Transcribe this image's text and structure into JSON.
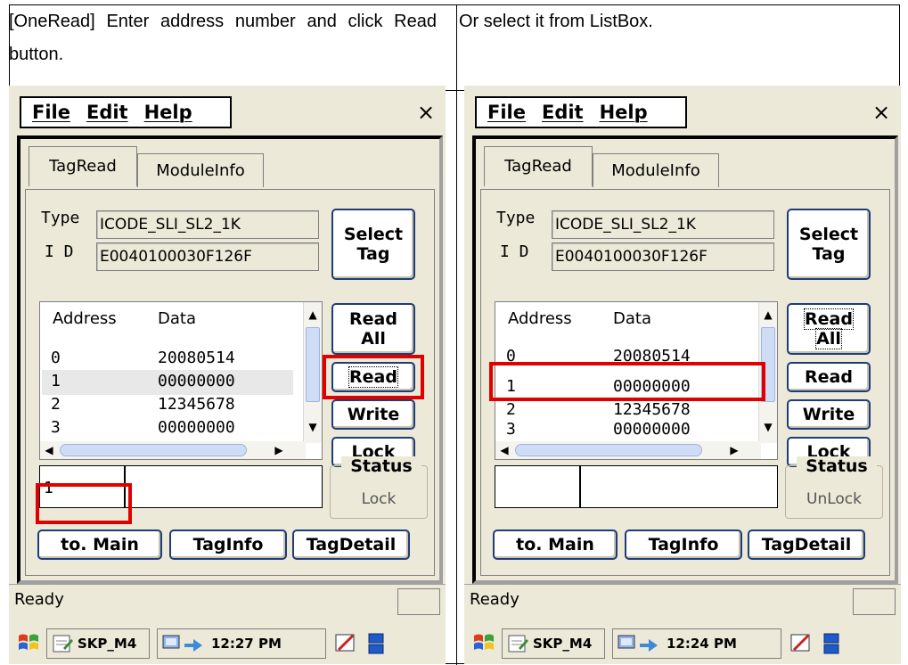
{
  "captions": {
    "left": "[OneRead] Enter address number and click Read button.",
    "right": "Or select it from ListBox."
  },
  "menu": {
    "file": "File",
    "edit": "Edit",
    "help": "Help",
    "close": "×"
  },
  "tabs": {
    "tagread": "TagRead",
    "moduleinfo": "ModuleInfo"
  },
  "labels": {
    "type": "Type",
    "id": "I D"
  },
  "tag": {
    "type_value": "ICODE_SLI_SL2_1K",
    "id_value": "E0040100030F126F"
  },
  "buttons": {
    "select_tag_line1": "Select",
    "select_tag_line2": "Tag",
    "read_all_line1": "Read",
    "read_all_line2": "All",
    "read": "Read",
    "write": "Write",
    "lock": "Lock",
    "to_main": "to. Main",
    "taginfo": "TagInfo",
    "tagdetail": "TagDetail"
  },
  "list": {
    "headers": {
      "address": "Address",
      "data": "Data"
    },
    "rows": [
      {
        "address": "0",
        "data": "20080514"
      },
      {
        "address": "1",
        "data": "00000000"
      },
      {
        "address": "2",
        "data": "12345678"
      },
      {
        "address": "3",
        "data": "00000000"
      }
    ]
  },
  "status": {
    "title": "Status",
    "left_value": "Lock",
    "right_value": "UnLock"
  },
  "inputs": {
    "left_address": "1",
    "left_data": "",
    "right_address": "",
    "right_data": ""
  },
  "statusbar": {
    "text": "Ready"
  },
  "taskbar": {
    "app": "SKP_M4",
    "time_left": "12:27 PM",
    "time_right": "12:24 PM"
  },
  "colors": {
    "highlight": "#e00000",
    "button_border": "#1e3c78",
    "window_bg": "#ece9d8"
  }
}
